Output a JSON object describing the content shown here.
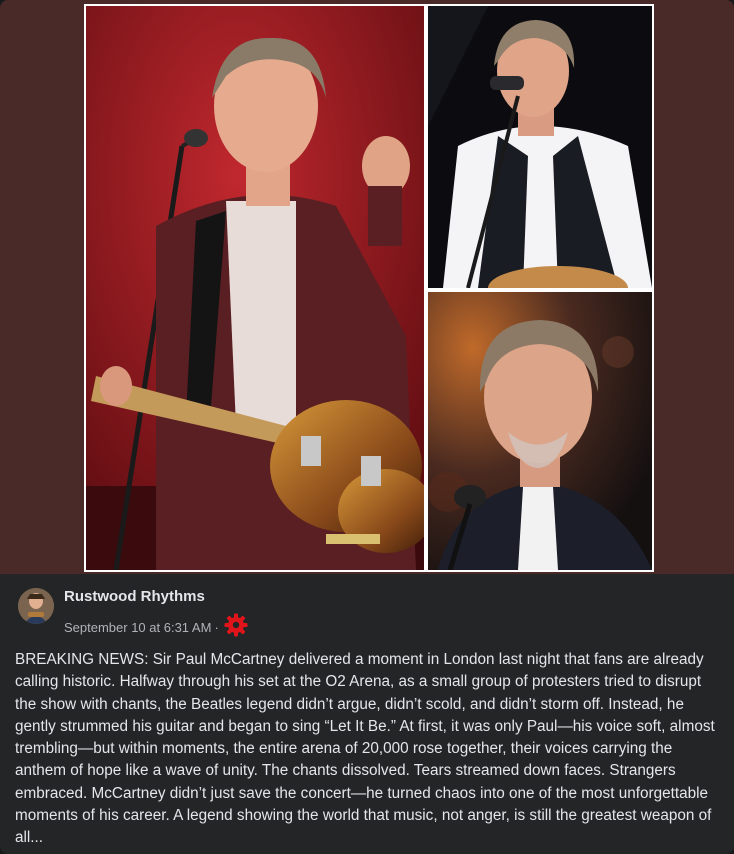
{
  "post": {
    "author": "Rustwood Rhythms",
    "timestamp": "September 10 at 6:31 AM",
    "separator": "·",
    "audience_icon": "gear-icon",
    "text": "BREAKING NEWS: Sir Paul McCartney delivered a moment in London last night that fans are already calling historic. Halfway through his set at the O2 Arena, as a small group of protesters tried to disrupt the show with chants, the Beatles legend didn’t argue, didn’t scold, and didn’t storm off. Instead, he gently strummed his guitar and began to sing “Let It Be.” At first, it was only Paul—his voice soft, almost trembling—but within moments, the entire arena of 20,000 rose together, their voices carrying the anthem of hope like a wave of unity. The chants dissolved. Tears streamed down faces. Strangers embraced. McCartney didn’t just save the concert—he turned chaos into one of the most unforgettable moments of his career. A legend showing the world that music, not anger, is still the greatest weapon of all..."
  },
  "colors": {
    "background": "#242526",
    "media_background": "#4a2a28",
    "text_primary": "#e4e6eb",
    "text_secondary": "#b0b3b8",
    "gear_accent": "#e0151b"
  }
}
